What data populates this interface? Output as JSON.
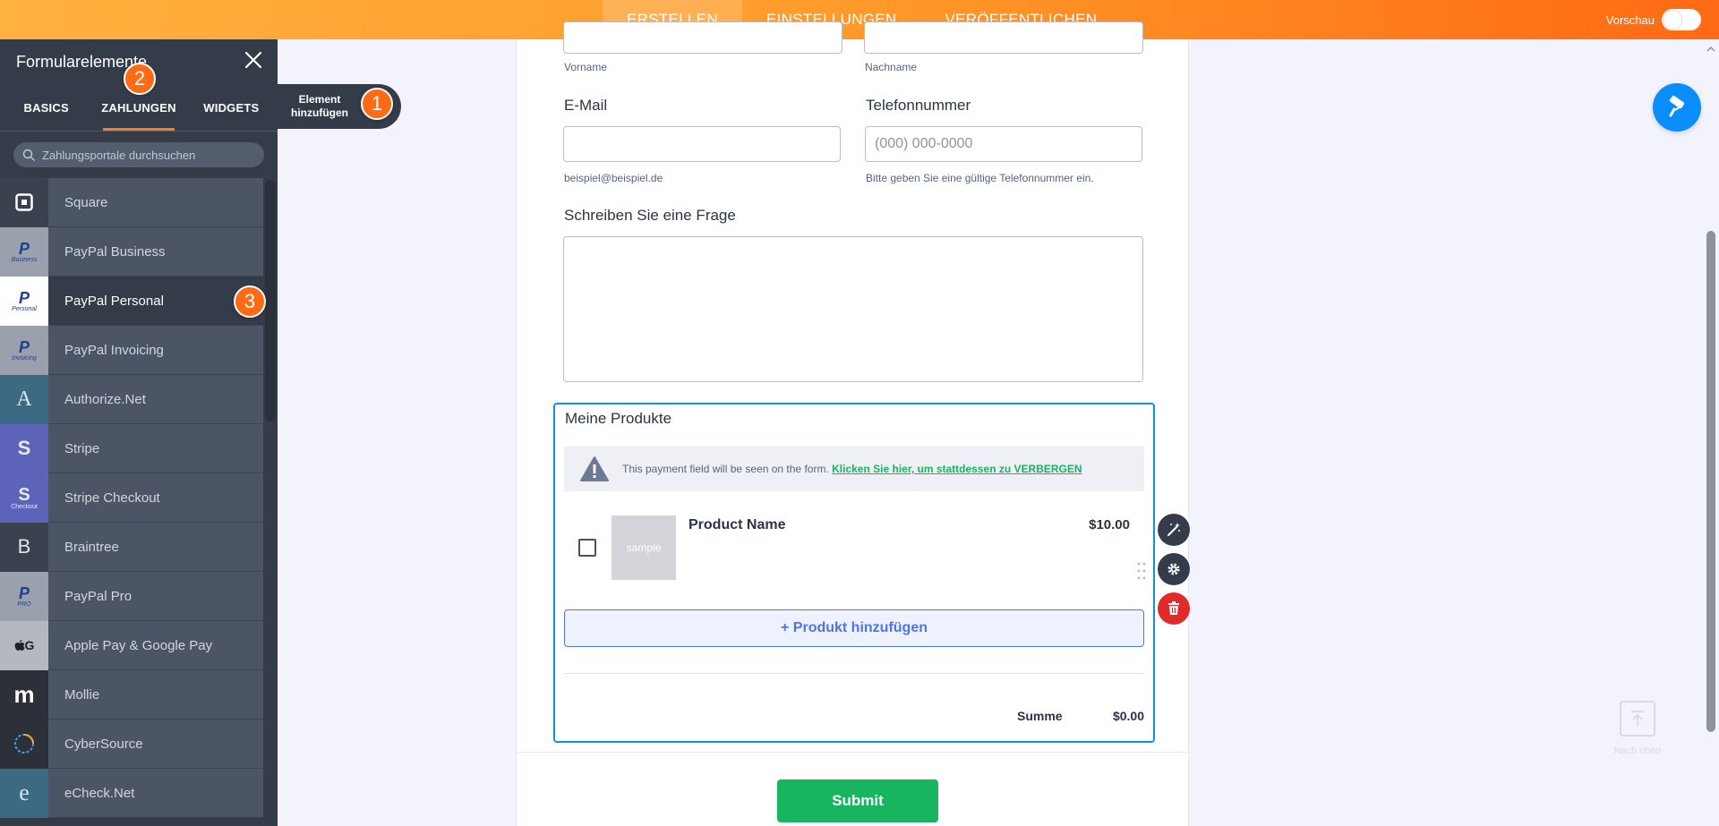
{
  "topbar": {
    "tabs": [
      {
        "label": "ERSTELLEN",
        "active": true
      },
      {
        "label": "EINSTELLUNGEN",
        "active": false
      },
      {
        "label": "VERÖFFENTLICHEN",
        "active": false
      }
    ],
    "preview_label": "Vorschau"
  },
  "sidebar": {
    "title": "Formularelemente",
    "tabs": [
      {
        "label": "BASICS",
        "active": false
      },
      {
        "label": "ZAHLUNGEN",
        "active": true
      },
      {
        "label": "WIDGETS",
        "active": false
      }
    ],
    "search_placeholder": "Zahlungsportale durchsuchen",
    "items": [
      {
        "label": "Square",
        "icon": "square-icon"
      },
      {
        "label": "PayPal Business",
        "icon": "paypal-business-icon",
        "sub": "Business"
      },
      {
        "label": "PayPal Personal",
        "icon": "paypal-personal-icon",
        "sub": "Personal",
        "selected": true
      },
      {
        "label": "PayPal Invoicing",
        "icon": "paypal-invoicing-icon",
        "sub": "Invoicing"
      },
      {
        "label": "Authorize.Net",
        "icon": "authorize-net-icon",
        "glyph": "A"
      },
      {
        "label": "Stripe",
        "icon": "stripe-icon",
        "glyph": "S"
      },
      {
        "label": "Stripe Checkout",
        "icon": "stripe-checkout-icon",
        "glyph": "S",
        "sub": "Checkout"
      },
      {
        "label": "Braintree",
        "icon": "braintree-icon",
        "glyph": "B"
      },
      {
        "label": "PayPal Pro",
        "icon": "paypal-pro-icon",
        "sub": "PRO"
      },
      {
        "label": "Apple Pay & Google Pay",
        "icon": "apple-google-pay-icon",
        "glyph": "G"
      },
      {
        "label": "Mollie",
        "icon": "mollie-icon",
        "glyph": "m"
      },
      {
        "label": "CyberSource",
        "icon": "cybersource-icon"
      },
      {
        "label": "eCheck.Net",
        "icon": "echeck-net-icon",
        "glyph": "e"
      }
    ]
  },
  "add_element": {
    "line1": "Element",
    "line2": "hinzufügen"
  },
  "badges": [
    "1",
    "2",
    "3"
  ],
  "form": {
    "first_name_sublabel": "Vorname",
    "last_name_sublabel": "Nachname",
    "email_label": "E-Mail",
    "email_sublabel": "beispiel@beispiel.de",
    "phone_label": "Telefonnummer",
    "phone_placeholder": "(000) 000-0000",
    "phone_sublabel": "Bitte geben Sie eine gültige Telefonnummer ein.",
    "question_label": "Schreiben Sie eine Frage",
    "payment": {
      "title": "Meine Produkte",
      "warning_text": "This payment field will be seen on the form.",
      "warning_link": "Klicken Sie hier, um stattdessen zu VERBERGEN",
      "product_name": "Product Name",
      "product_price": "$10.00",
      "product_image_text": "sample",
      "add_product": "+ Produkt hinzufügen",
      "sum_label": "Summe",
      "sum_value": "$0.00"
    },
    "submit_label": "Submit"
  },
  "back_to_top": "Nach oben",
  "colors": {
    "accent_orange": "#ff6a14",
    "submit_green": "#18b560",
    "selection_blue": "#0e90e8",
    "sidebar_dark": "#343c4a"
  }
}
